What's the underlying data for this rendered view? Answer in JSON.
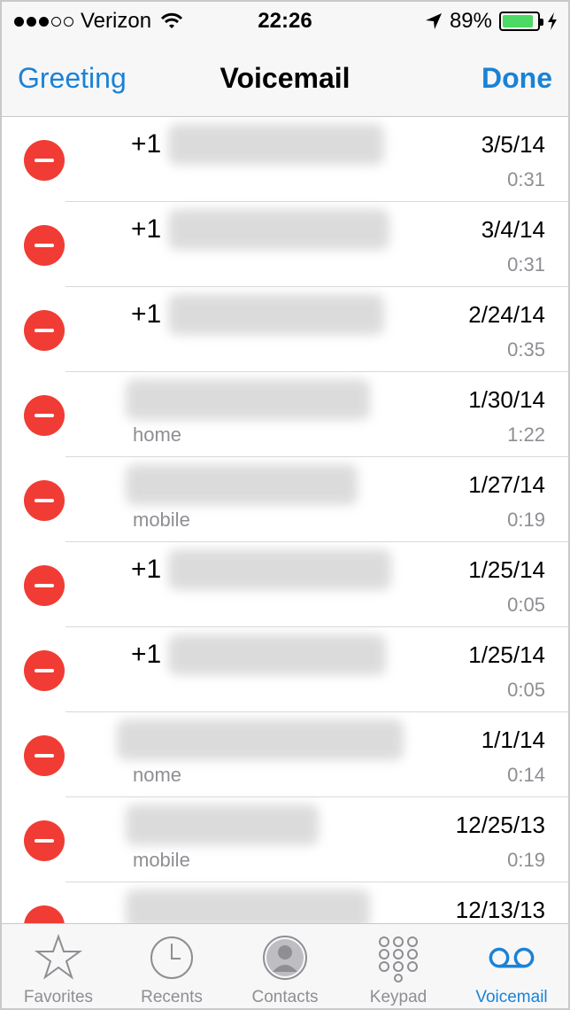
{
  "status": {
    "carrier": "Verizon",
    "time": "22:26",
    "battery": "89%",
    "battery_level": 0.89,
    "signal_bars_filled": 3,
    "signal_bars_total": 5
  },
  "nav": {
    "left": "Greeting",
    "title": "Voicemail",
    "right": "Done"
  },
  "voicemails": [
    {
      "prefix": "+1",
      "label": "",
      "date": "3/5/14",
      "duration": "0:31"
    },
    {
      "prefix": "+1",
      "label": "",
      "date": "3/4/14",
      "duration": "0:31"
    },
    {
      "prefix": "+1",
      "label": "",
      "date": "2/24/14",
      "duration": "0:35"
    },
    {
      "prefix": "",
      "label": "home",
      "date": "1/30/14",
      "duration": "1:22"
    },
    {
      "prefix": "",
      "label": "mobile",
      "date": "1/27/14",
      "duration": "0:19"
    },
    {
      "prefix": "+1",
      "label": "",
      "date": "1/25/14",
      "duration": "0:05"
    },
    {
      "prefix": "+1",
      "label": "",
      "date": "1/25/14",
      "duration": "0:05"
    },
    {
      "prefix": "",
      "label": "nome",
      "date": "1/1/14",
      "duration": "0:14"
    },
    {
      "prefix": "",
      "label": "mobile",
      "date": "12/25/13",
      "duration": "0:19"
    },
    {
      "prefix": "",
      "label": "",
      "date": "12/13/13",
      "duration": ""
    }
  ],
  "tabs": [
    {
      "label": "Favorites",
      "icon": "star-icon"
    },
    {
      "label": "Recents",
      "icon": "clock-icon"
    },
    {
      "label": "Contacts",
      "icon": "contacts-icon"
    },
    {
      "label": "Keypad",
      "icon": "keypad-icon"
    },
    {
      "label": "Voicemail",
      "icon": "voicemail-icon"
    }
  ],
  "colors": {
    "accent": "#1a82d6",
    "delete": "#f03c34",
    "battery": "#4cd964",
    "secondary_text": "#8e8e93"
  }
}
